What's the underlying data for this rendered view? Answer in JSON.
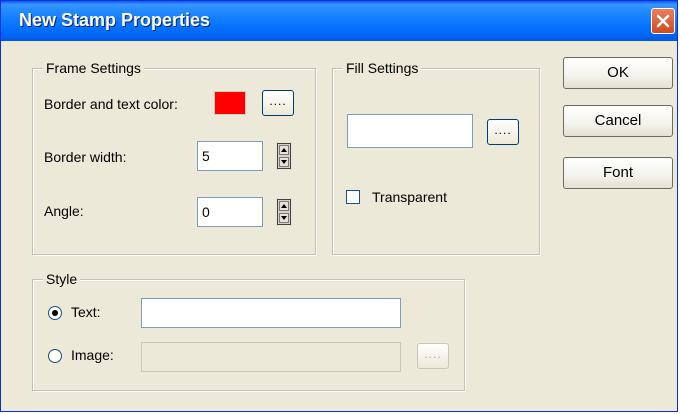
{
  "window": {
    "title": "New Stamp Properties"
  },
  "frame_settings": {
    "legend": "Frame Settings",
    "border_color_label": "Border and text color:",
    "border_color": "#ff0000",
    "browse_label": "....",
    "border_width_label": "Border width:",
    "border_width_value": "5",
    "angle_label": "Angle:",
    "angle_value": "0"
  },
  "fill_settings": {
    "legend": "Fill Settings",
    "fill_value": "",
    "browse_label": "....",
    "transparent_label": "Transparent",
    "transparent_checked": false
  },
  "style": {
    "legend": "Style",
    "text_label": "Text:",
    "text_value": "",
    "text_selected": true,
    "image_label": "Image:",
    "image_value": "",
    "browse_label": "...."
  },
  "buttons": {
    "ok": "OK",
    "cancel": "Cancel",
    "font": "Font"
  },
  "icons": {
    "close": "close-icon",
    "spin_up": "triangle-up-icon",
    "spin_down": "triangle-down-icon"
  }
}
